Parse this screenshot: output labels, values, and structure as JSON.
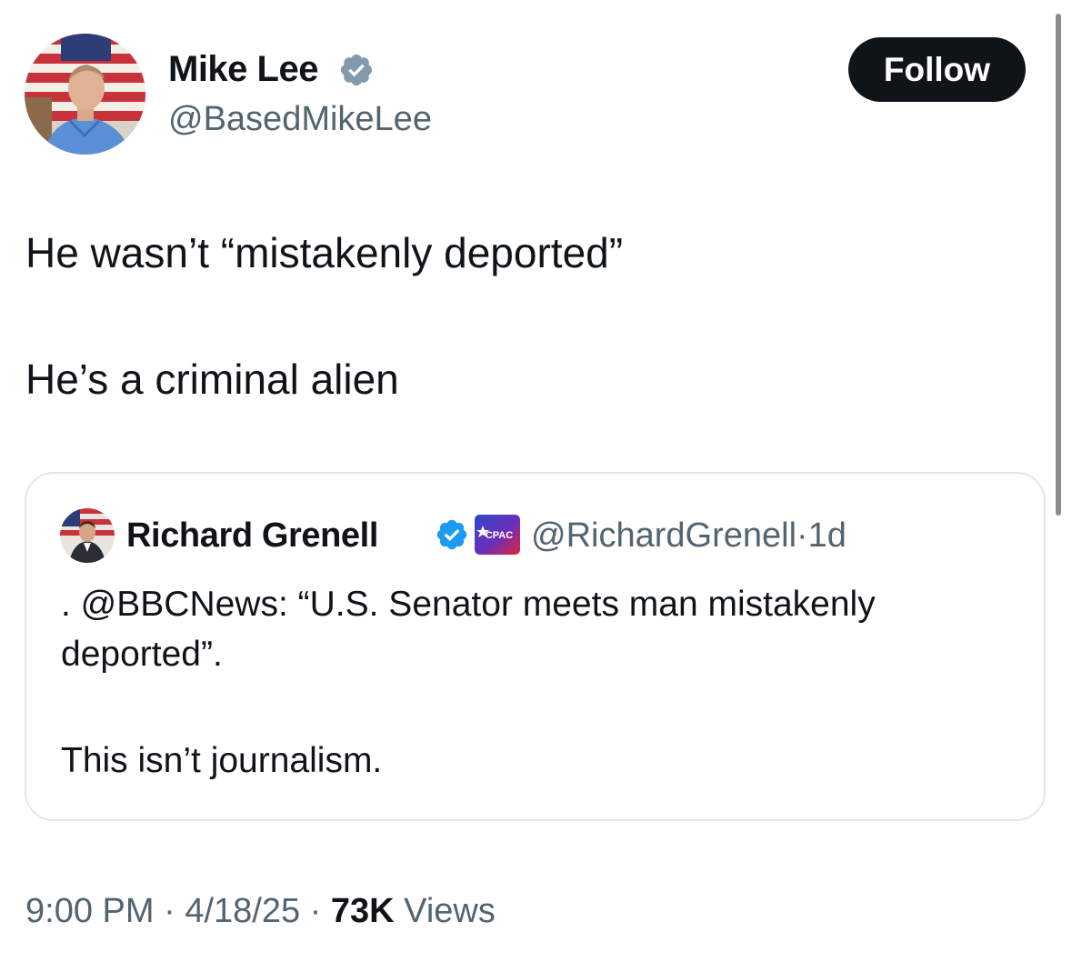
{
  "author": {
    "display_name": "Mike Lee",
    "handle": "@BasedMikeLee",
    "verified_icon": "verified-badge-icon",
    "verified_color": "#829aab"
  },
  "follow_button": {
    "label": "Follow",
    "bg_color": "#0f1419",
    "text_color": "#ffffff"
  },
  "tweet": {
    "lines": [
      "He wasn’t “mistakenly deported”",
      "He’s a criminal alien"
    ]
  },
  "quoted_tweet": {
    "display_name": "Richard Grenell",
    "verified_icon": "verified-badge-icon",
    "verified_color": "#1d9bf0",
    "affiliate_badge": "CPAC",
    "handle": "@RichardGrenell",
    "separator": "·",
    "time_ago": "1d",
    "lines": [
      ". @BBCNews: “U.S. Senator meets man mistakenly",
      "deported”.",
      "This isn’t journalism."
    ]
  },
  "footer": {
    "time": "9:00 PM",
    "date": "4/18/25",
    "separator": "·",
    "views_count": "73K",
    "views_label": "Views"
  },
  "colors": {
    "text_primary": "#0f1419",
    "text_secondary": "#536471",
    "card_border": "#e1e8ed"
  }
}
